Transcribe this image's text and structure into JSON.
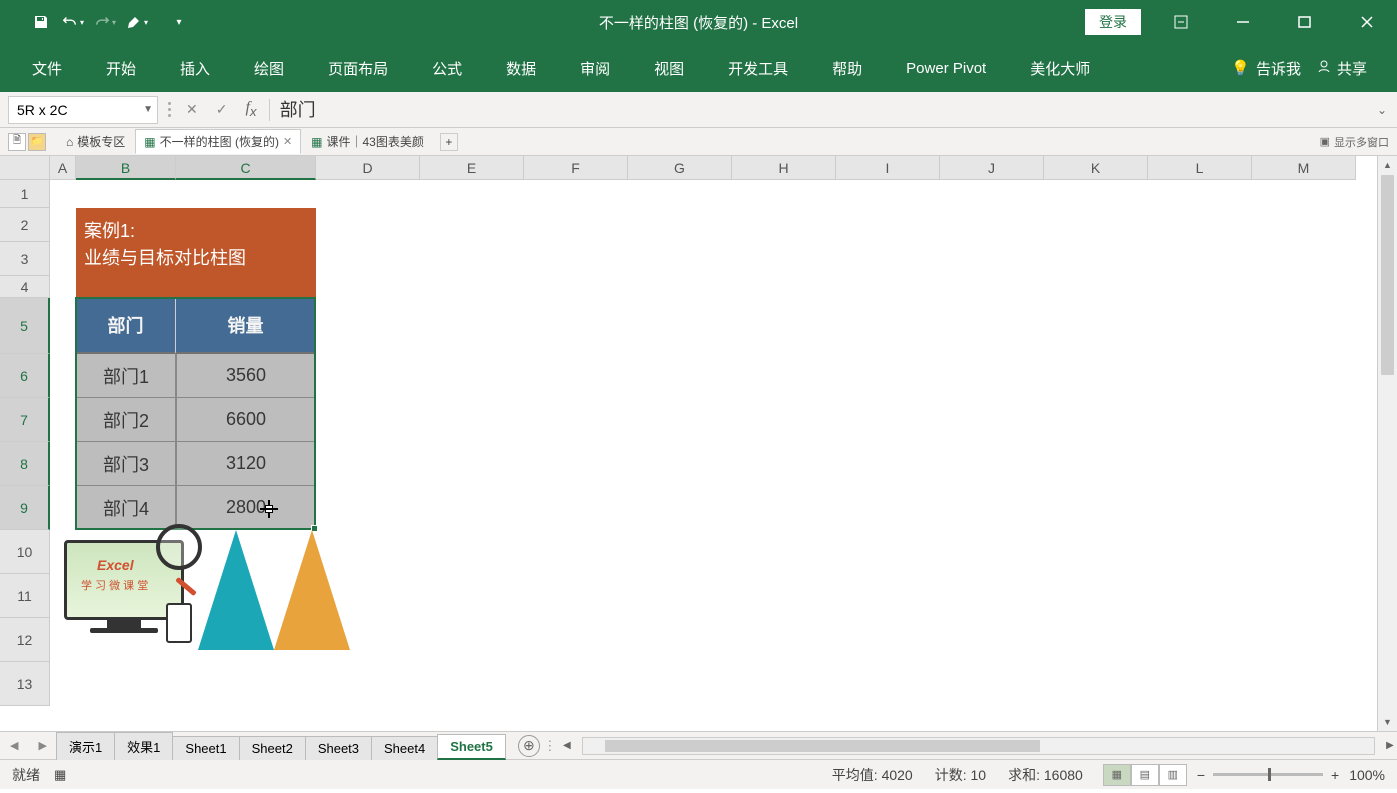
{
  "title": "不一样的柱图 (恢复的)  -  Excel",
  "qat": {
    "save": "save",
    "undo": "undo",
    "redo": "redo",
    "brush": "brush"
  },
  "titlebar_buttons": {
    "login": "登录"
  },
  "ribbon": {
    "tabs": [
      "文件",
      "开始",
      "插入",
      "绘图",
      "页面布局",
      "公式",
      "数据",
      "审阅",
      "视图",
      "开发工具",
      "帮助",
      "Power Pivot",
      "美化大师"
    ],
    "tellme": "告诉我",
    "share": "共享"
  },
  "namebox": "5R x 2C",
  "formula_value": "部门",
  "doctabs": {
    "template_zone": "模板专区",
    "active": "不一样的柱图 (恢复的)",
    "other": "课件｜43图表美颜",
    "show_multi": "显示多窗口"
  },
  "columns": [
    "A",
    "B",
    "C",
    "D",
    "E",
    "F",
    "G",
    "H",
    "I",
    "J",
    "K",
    "L",
    "M"
  ],
  "col_widths": {
    "A": 26,
    "B": 100,
    "C": 140,
    "default": 104
  },
  "rows": [
    1,
    2,
    3,
    4,
    5,
    6,
    7,
    8,
    9,
    10,
    11,
    12,
    13
  ],
  "row_heights": {
    "1": 28,
    "2": 34,
    "3": 34,
    "4": 22,
    "5": 56,
    "6": 44,
    "7": 44,
    "8": 44,
    "9": 44,
    "10": 44,
    "11": 44,
    "12": 44,
    "13": 44
  },
  "case_header_line1": "案例1:",
  "case_header_line2": "业绩与目标对比柱图",
  "table": {
    "headers": [
      "部门",
      "销量"
    ],
    "rows": [
      {
        "dept": "部门1",
        "sales": "3560"
      },
      {
        "dept": "部门2",
        "sales": "6600"
      },
      {
        "dept": "部门3",
        "sales": "3120"
      },
      {
        "dept": "部门4",
        "sales": "2800"
      }
    ]
  },
  "logo": {
    "line1": "Excel",
    "line2": "学 习 微 课 堂"
  },
  "sheettabs": [
    "演示1",
    "效果1",
    "Sheet1",
    "Sheet2",
    "Sheet3",
    "Sheet4",
    "Sheet5"
  ],
  "sheettabs_active": "Sheet5",
  "status": {
    "ready": "就绪",
    "avg_label": "平均值:",
    "avg_value": "4020",
    "count_label": "计数:",
    "count_value": "10",
    "sum_label": "求和:",
    "sum_value": "16080",
    "zoom": "100%"
  },
  "chart_data": {
    "type": "bar",
    "categories": [
      "部门1",
      "部门2",
      "部门3",
      "部门4"
    ],
    "values": [
      3560,
      6600,
      3120,
      2800
    ],
    "title": "业绩与目标对比柱图",
    "xlabel": "部门",
    "ylabel": "销量"
  }
}
